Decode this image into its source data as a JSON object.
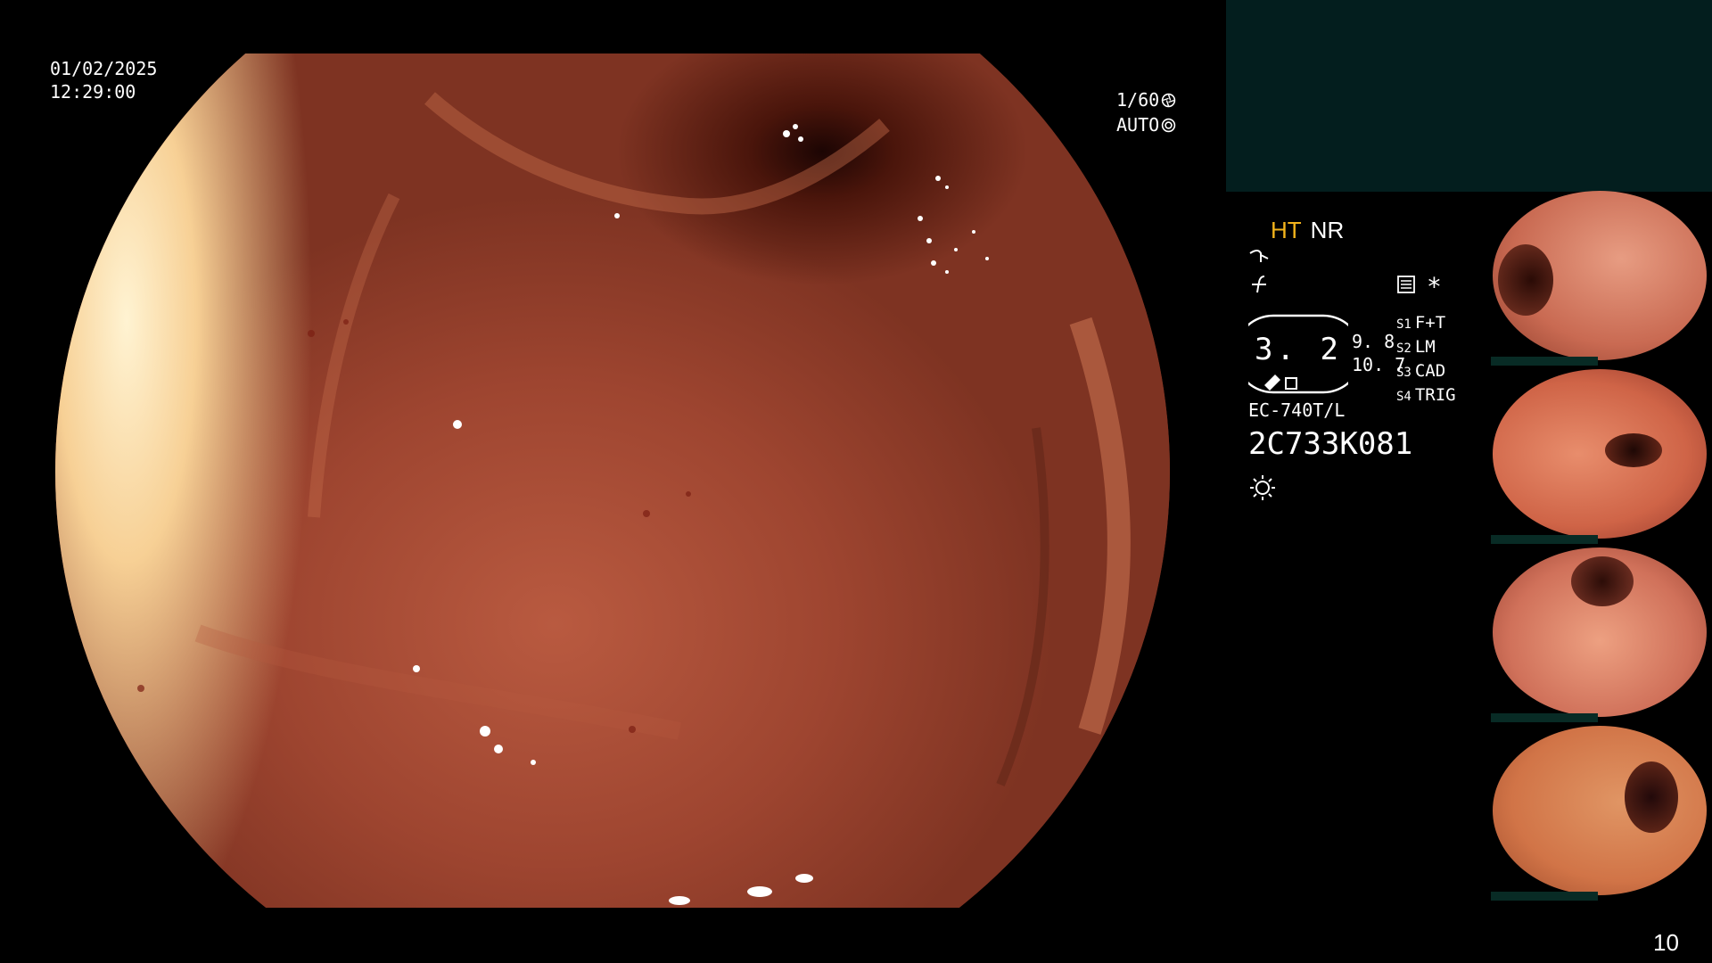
{
  "overlay": {
    "date": "01/02/2025",
    "time": "12:29:00",
    "shutter": "1/60",
    "exposure_mode": "AUTO",
    "page_number": "10"
  },
  "panel": {
    "mode_primary": "HT",
    "mode_secondary": "NR",
    "icons": [
      "scope-curve-icon",
      "signal-icon",
      "image-settings-icon",
      "asterisk-icon",
      "light-source-icon"
    ],
    "asterisk": "*",
    "dial_value": "3. 2",
    "dial_side_top": "9. 8",
    "dial_side_bottom": "10. 7",
    "switches": [
      {
        "label": "S1",
        "value": "F+T"
      },
      {
        "label": "S2",
        "value": "LM"
      },
      {
        "label": "S3",
        "value": "CAD"
      },
      {
        "label": "S4",
        "value": "TRIG"
      }
    ],
    "scope_model": "EC-740T/L",
    "scope_serial": "2C733K081"
  },
  "thumbnails": [
    {
      "name": "thumbnail-1"
    },
    {
      "name": "thumbnail-2"
    },
    {
      "name": "thumbnail-3"
    },
    {
      "name": "thumbnail-4"
    }
  ],
  "colors": {
    "background": "#000000",
    "text": "#ffffff",
    "ht_accent": "#f2b31c",
    "top_box": "#031e1e"
  }
}
